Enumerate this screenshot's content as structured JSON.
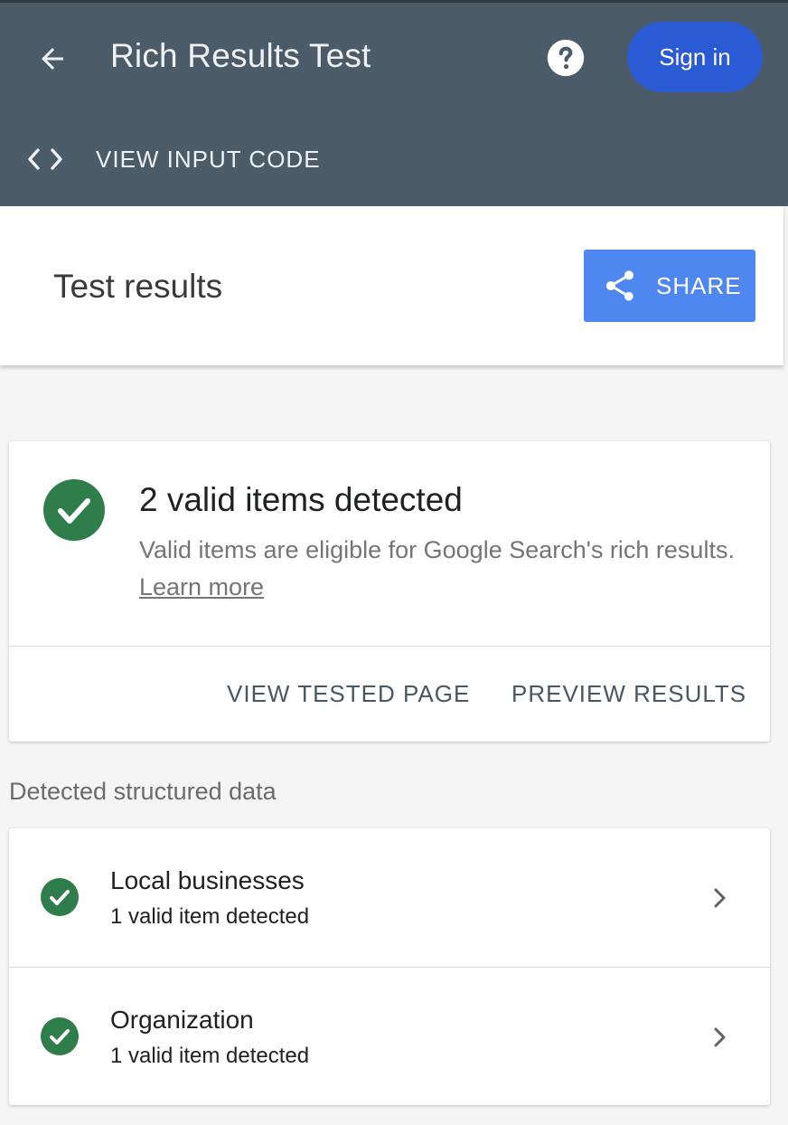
{
  "header": {
    "title": "Rich Results Test",
    "sign_in_label": "Sign in",
    "view_code_label": "VIEW INPUT CODE"
  },
  "results_bar": {
    "title": "Test results",
    "share_label": "SHARE"
  },
  "summary": {
    "headline": "2 valid items detected",
    "description": "Valid items are eligible for Google Search's rich results.",
    "learn_more": "Learn more",
    "view_tested_page": "VIEW TESTED PAGE",
    "preview_results": "PREVIEW RESULTS"
  },
  "detected": {
    "section_label": "Detected structured data",
    "items": [
      {
        "title": "Local businesses",
        "subtitle": "1 valid item detected"
      },
      {
        "title": "Organization",
        "subtitle": "1 valid item detected"
      }
    ]
  },
  "colors": {
    "header_bg": "#4b5b68",
    "sign_in_bg": "#2a5bd4",
    "share_bg": "#4f87f0",
    "valid_green": "#2e7d4a"
  }
}
